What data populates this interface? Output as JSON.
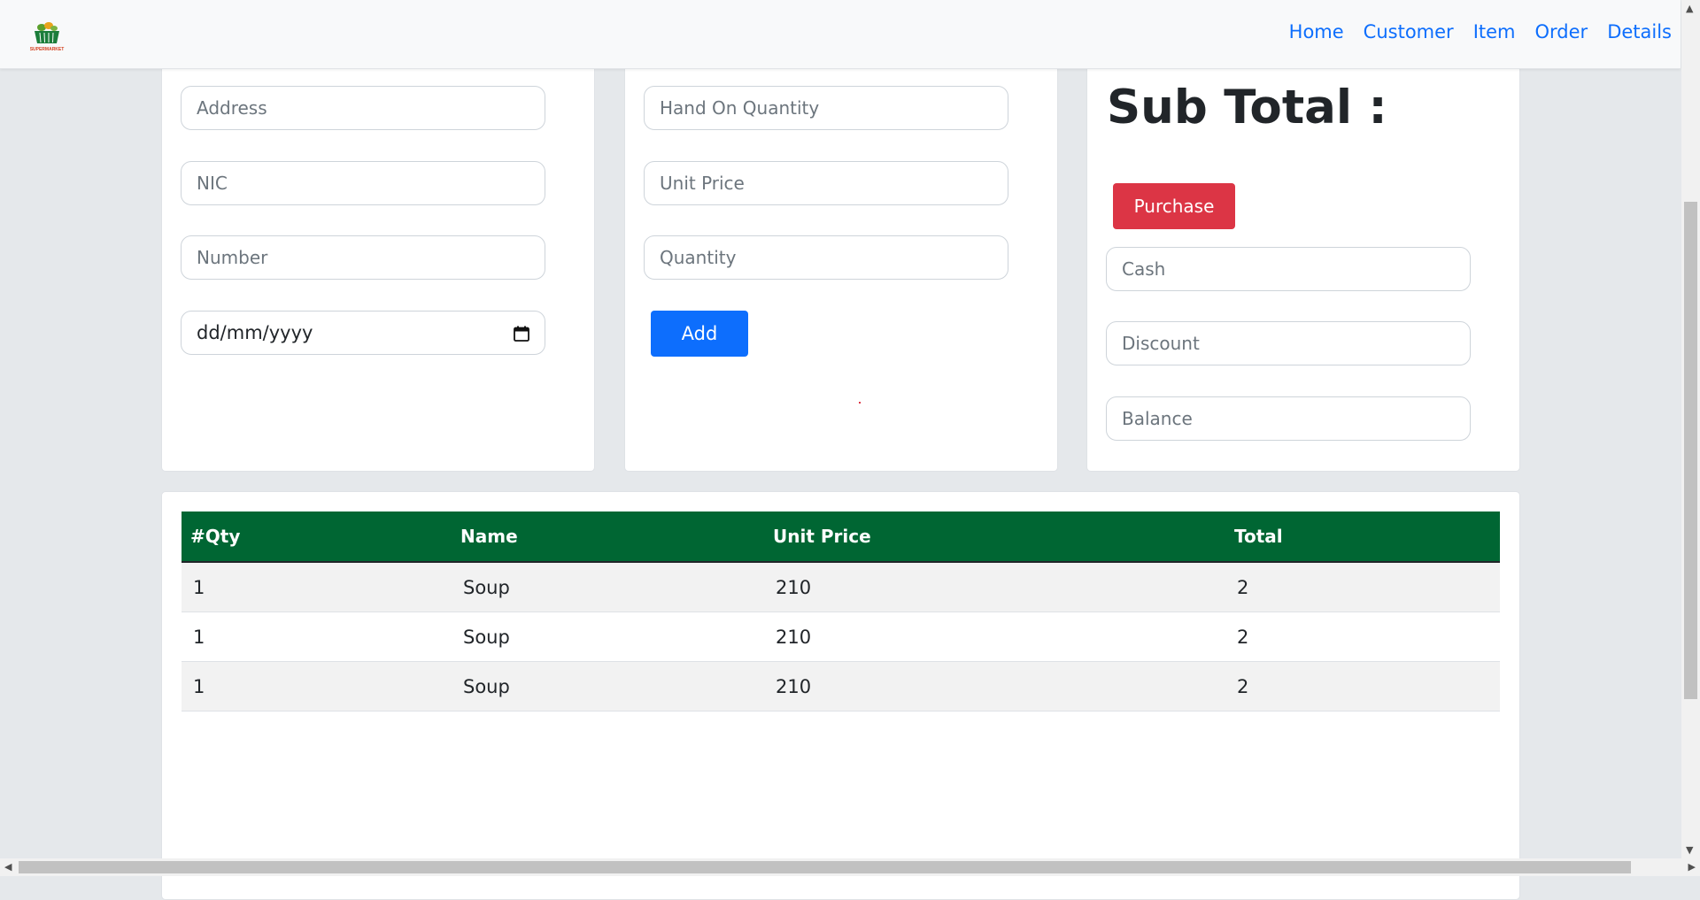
{
  "navbar": {
    "logo_text": "SUPERMARKET",
    "links": [
      "Home",
      "Customer",
      "Item",
      "Order",
      "Details"
    ]
  },
  "customer_form": {
    "address_placeholder": "Address",
    "nic_placeholder": "NIC",
    "number_placeholder": "Number",
    "date_value": "dd/mm/yyyy"
  },
  "item_form": {
    "hand_on_quantity_placeholder": "Hand On Quantity",
    "unit_price_placeholder": "Unit Price",
    "quantity_placeholder": "Quantity",
    "add_label": "Add"
  },
  "payment": {
    "subtotal_label": "Sub Total :",
    "purchase_label": "Purchase",
    "cash_placeholder": "Cash",
    "discount_placeholder": "Discount",
    "balance_placeholder": "Balance"
  },
  "cart_table": {
    "headers": [
      "#Qty",
      "Name",
      "Unit Price",
      "Total"
    ],
    "rows": [
      [
        "1",
        "Soup",
        "210",
        "2"
      ],
      [
        "1",
        "Soup",
        "210",
        "2"
      ],
      [
        "1",
        "Soup",
        "210",
        "2"
      ]
    ]
  },
  "colors": {
    "primary": "#0d6efd",
    "danger": "#dc3545",
    "table_header": "#006633"
  }
}
